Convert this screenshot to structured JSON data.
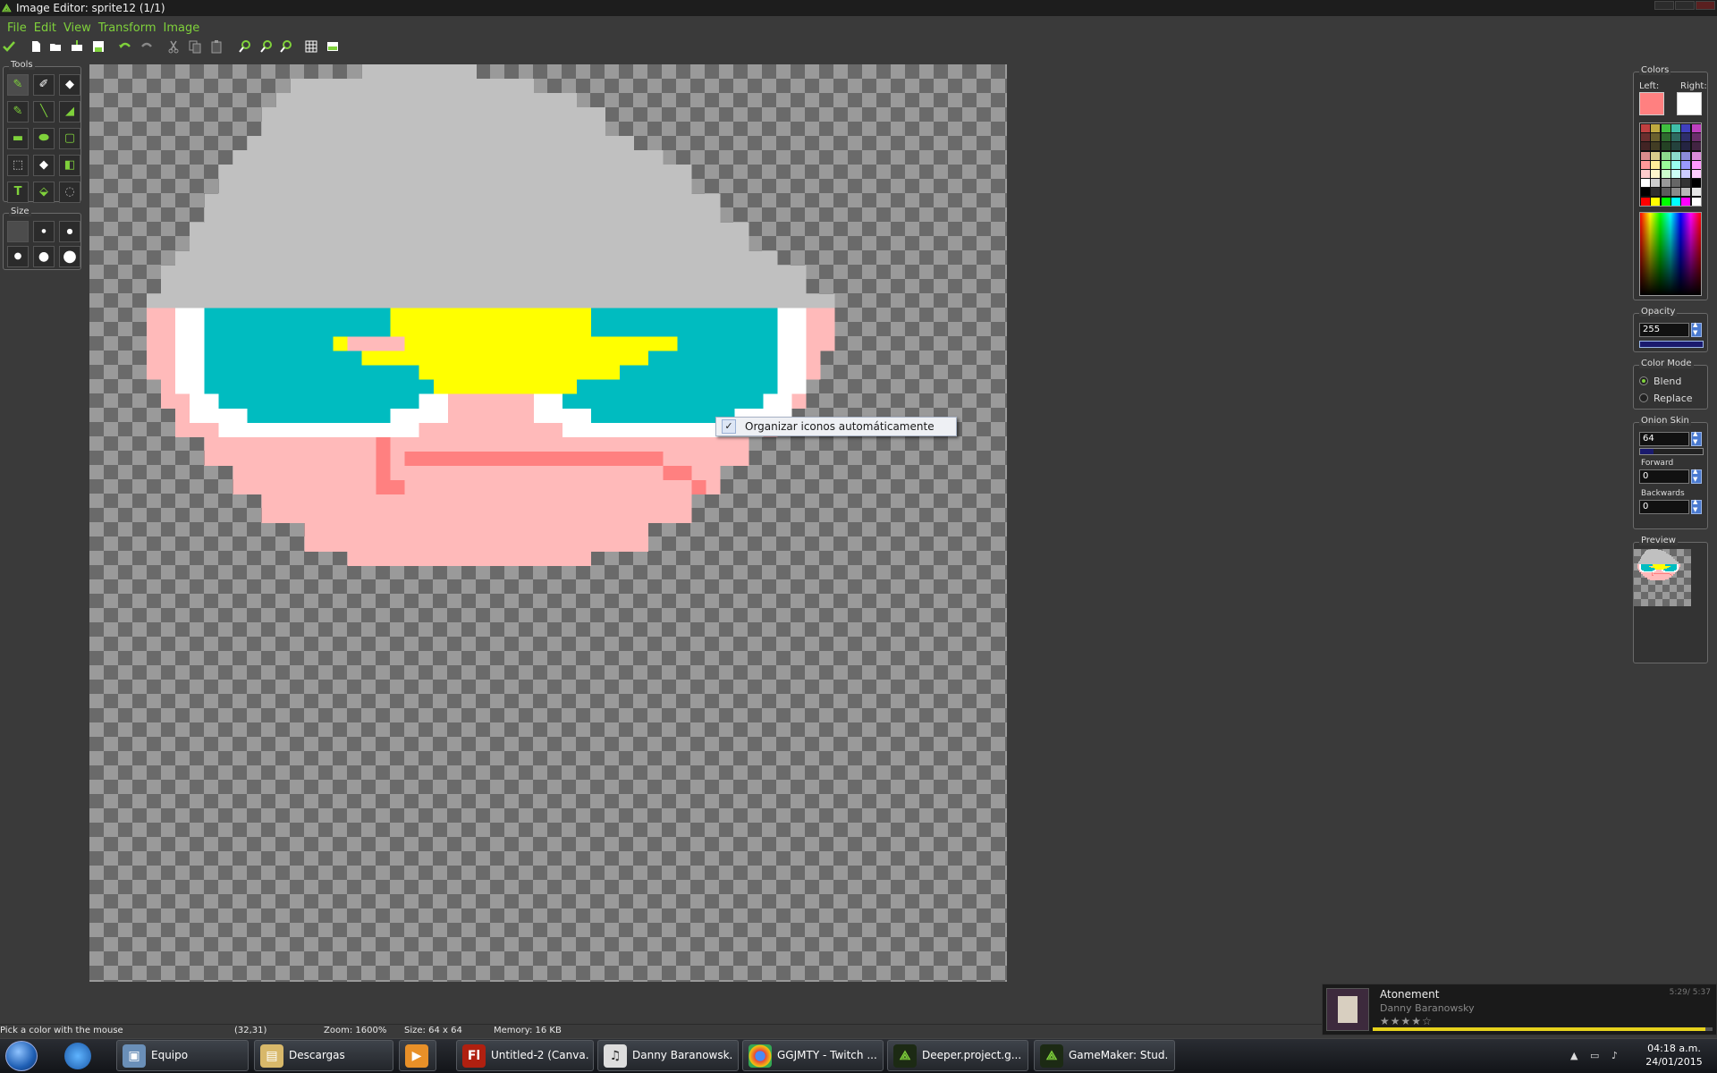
{
  "window": {
    "title": "Image Editor: sprite12 (1/1)"
  },
  "menu": [
    "File",
    "Edit",
    "View",
    "Transform",
    "Image"
  ],
  "toolbar": {
    "icons": [
      "confirm-icon",
      "new-icon",
      "open-icon",
      "import-icon",
      "save-icon",
      "undo-icon",
      "redo-icon",
      "cut-icon",
      "copy-icon",
      "paste-icon",
      "zoom-in-icon",
      "zoom-out-icon",
      "zoom-reset-icon",
      "grid-icon",
      "image-icon"
    ]
  },
  "tools": {
    "label": "Tools",
    "size_label": "Size"
  },
  "colors": {
    "label": "Colors",
    "left_label": "Left:",
    "right_label": "Right:",
    "left_color": "#ff8080",
    "right_color": "#ffffff"
  },
  "opacity": {
    "label": "Opacity",
    "value": "255"
  },
  "color_mode": {
    "label": "Color Mode",
    "options": [
      "Blend",
      "Replace"
    ],
    "selected": "Blend"
  },
  "onion_skin": {
    "label": "Onion Skin",
    "value": "64",
    "forward_label": "Forward",
    "forward_value": "0",
    "backwards_label": "Backwards",
    "backwards_value": "0"
  },
  "preview": {
    "label": "Preview"
  },
  "context_menu": {
    "item": "Organizar iconos automáticamente",
    "checked": true
  },
  "status": {
    "hint": "Pick a color with the mouse",
    "coords": "(32,31)",
    "zoom": "Zoom: 1600%",
    "size": "Size: 64 x 64",
    "memory": "Memory: 16 KB"
  },
  "media": {
    "song": "Atonement",
    "artist": "Danny Baranowsky",
    "time": "5:29/ 5:37",
    "rating": 4,
    "progress": 0.98
  },
  "taskbar": {
    "items": [
      {
        "label": "Equipo",
        "icon": "computer-icon"
      },
      {
        "label": "Descargas",
        "icon": "folder-icon"
      },
      {
        "label": "",
        "icon": "media-player-icon"
      },
      {
        "label": "Untitled-2 (Canva...",
        "icon": "flash-icon"
      },
      {
        "label": "Danny Baranowsk...",
        "icon": "music-player-icon"
      },
      {
        "label": "GGJMTY - Twitch ...",
        "icon": "chrome-icon"
      },
      {
        "label": "Deeper.project.g...",
        "icon": "gamemaker-icon"
      },
      {
        "label": "GameMaker: Stud...",
        "icon": "gamemaker-icon"
      }
    ],
    "clock_time": "04:18 a.m.",
    "clock_date": "24/01/2015"
  },
  "sprite_palette": {
    "hat": "#c0c0c0",
    "skin": "#ffbaba",
    "white": "#ffffff",
    "teal": "#00bcc0",
    "yellow": "#ffff00",
    "mouth": "#ff8080"
  }
}
